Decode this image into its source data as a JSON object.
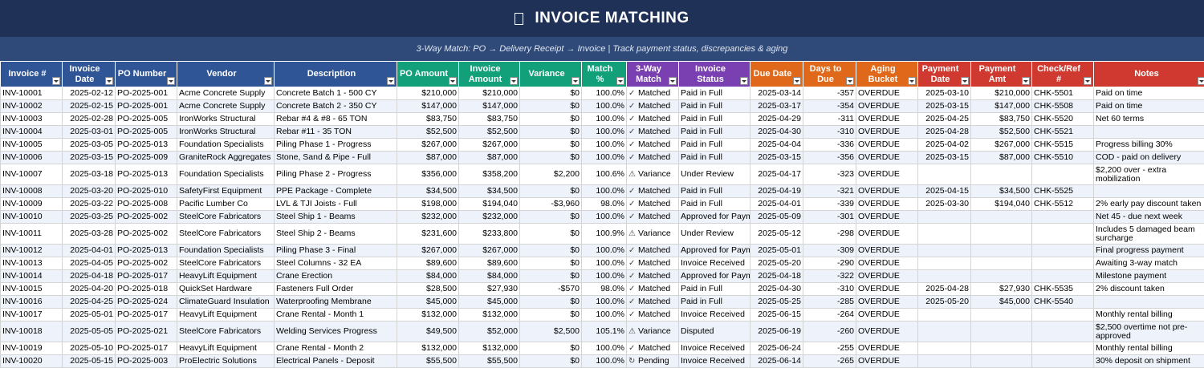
{
  "header": {
    "title": "INVOICE MATCHING",
    "subtitle": "3-Way Match: PO → Delivery Receipt → Invoice  |  Track payment status, discrepancies & aging"
  },
  "columns": [
    {
      "label": "Invoice #",
      "color": "#2f5597"
    },
    {
      "label": "Invoice Date",
      "color": "#2f5597"
    },
    {
      "label": "PO Number",
      "color": "#2f5597"
    },
    {
      "label": "Vendor",
      "color": "#2f5597"
    },
    {
      "label": "Description",
      "color": "#2f5597"
    },
    {
      "label": "PO Amount",
      "color": "#12a07a"
    },
    {
      "label": "Invoice Amount",
      "color": "#12a07a"
    },
    {
      "label": "Variance",
      "color": "#12a07a"
    },
    {
      "label": "Match %",
      "color": "#12a07a"
    },
    {
      "label": "3-Way Match",
      "color": "#7a3fb0"
    },
    {
      "label": "Invoice Status",
      "color": "#7a3fb0"
    },
    {
      "label": "Due Date",
      "color": "#e0681a"
    },
    {
      "label": "Days to Due",
      "color": "#e0681a"
    },
    {
      "label": "Aging Bucket",
      "color": "#e0681a"
    },
    {
      "label": "Payment Date",
      "color": "#d0392f"
    },
    {
      "label": "Payment Amt",
      "color": "#d0392f"
    },
    {
      "label": "Check/Ref #",
      "color": "#d0392f"
    },
    {
      "label": "Notes",
      "color": "#d0392f"
    }
  ],
  "rows": [
    {
      "inv": "INV-10001",
      "date": "2025-02-12",
      "po": "PO-2025-001",
      "vendor": "Acme Concrete Supply",
      "desc": "Concrete Batch 1 - 500 CY",
      "po_amt": "$210,000",
      "inv_amt": "$210,000",
      "var": "$0",
      "pct": "100.0%",
      "match_icon": "check-icon",
      "match_sym": "✓",
      "match": "Matched",
      "status": "Paid in Full",
      "due": "2025-03-14",
      "days": "-357",
      "aging": "OVERDUE",
      "pay_date": "2025-03-10",
      "pay_amt": "$210,000",
      "ref": "CHK-5501",
      "notes": "Paid on time",
      "tall": false
    },
    {
      "inv": "INV-10002",
      "date": "2025-02-15",
      "po": "PO-2025-001",
      "vendor": "Acme Concrete Supply",
      "desc": "Concrete Batch 2 - 350 CY",
      "po_amt": "$147,000",
      "inv_amt": "$147,000",
      "var": "$0",
      "pct": "100.0%",
      "match_icon": "check-icon",
      "match_sym": "✓",
      "match": "Matched",
      "status": "Paid in Full",
      "due": "2025-03-17",
      "days": "-354",
      "aging": "OVERDUE",
      "pay_date": "2025-03-15",
      "pay_amt": "$147,000",
      "ref": "CHK-5508",
      "notes": "Paid on time",
      "tall": false
    },
    {
      "inv": "INV-10003",
      "date": "2025-02-28",
      "po": "PO-2025-005",
      "vendor": "IronWorks Structural",
      "desc": "Rebar #4 & #8 - 65 TON",
      "po_amt": "$83,750",
      "inv_amt": "$83,750",
      "var": "$0",
      "pct": "100.0%",
      "match_icon": "check-icon",
      "match_sym": "✓",
      "match": "Matched",
      "status": "Paid in Full",
      "due": "2025-04-29",
      "days": "-311",
      "aging": "OVERDUE",
      "pay_date": "2025-04-25",
      "pay_amt": "$83,750",
      "ref": "CHK-5520",
      "notes": "Net 60 terms",
      "tall": false
    },
    {
      "inv": "INV-10004",
      "date": "2025-03-01",
      "po": "PO-2025-005",
      "vendor": "IronWorks Structural",
      "desc": "Rebar #11 - 35 TON",
      "po_amt": "$52,500",
      "inv_amt": "$52,500",
      "var": "$0",
      "pct": "100.0%",
      "match_icon": "check-icon",
      "match_sym": "✓",
      "match": "Matched",
      "status": "Paid in Full",
      "due": "2025-04-30",
      "days": "-310",
      "aging": "OVERDUE",
      "pay_date": "2025-04-28",
      "pay_amt": "$52,500",
      "ref": "CHK-5521",
      "notes": "",
      "tall": false
    },
    {
      "inv": "INV-10005",
      "date": "2025-03-05",
      "po": "PO-2025-013",
      "vendor": "Foundation Specialists",
      "desc": "Piling Phase 1 - Progress",
      "po_amt": "$267,000",
      "inv_amt": "$267,000",
      "var": "$0",
      "pct": "100.0%",
      "match_icon": "check-icon",
      "match_sym": "✓",
      "match": "Matched",
      "status": "Paid in Full",
      "due": "2025-04-04",
      "days": "-336",
      "aging": "OVERDUE",
      "pay_date": "2025-04-02",
      "pay_amt": "$267,000",
      "ref": "CHK-5515",
      "notes": "Progress billing 30%",
      "tall": false
    },
    {
      "inv": "INV-10006",
      "date": "2025-03-15",
      "po": "PO-2025-009",
      "vendor": "GraniteRock Aggregates",
      "desc": "Stone, Sand & Pipe - Full",
      "po_amt": "$87,000",
      "inv_amt": "$87,000",
      "var": "$0",
      "pct": "100.0%",
      "match_icon": "check-icon",
      "match_sym": "✓",
      "match": "Matched",
      "status": "Paid in Full",
      "due": "2025-03-15",
      "days": "-356",
      "aging": "OVERDUE",
      "pay_date": "2025-03-15",
      "pay_amt": "$87,000",
      "ref": "CHK-5510",
      "notes": "COD - paid on delivery",
      "tall": false
    },
    {
      "inv": "INV-10007",
      "date": "2025-03-18",
      "po": "PO-2025-013",
      "vendor": "Foundation Specialists",
      "desc": "Piling Phase 2 - Progress",
      "po_amt": "$356,000",
      "inv_amt": "$358,200",
      "var": "$2,200",
      "pct": "100.6%",
      "match_icon": "warning-icon",
      "match_sym": "⚠",
      "match": "Variance",
      "status": "Under Review",
      "due": "2025-04-17",
      "days": "-323",
      "aging": "OVERDUE",
      "pay_date": "",
      "pay_amt": "",
      "ref": "",
      "notes": "$2,200 over - extra mobilization",
      "tall": true
    },
    {
      "inv": "INV-10008",
      "date": "2025-03-20",
      "po": "PO-2025-010",
      "vendor": "SafetyFirst Equipment",
      "desc": "PPE Package - Complete",
      "po_amt": "$34,500",
      "inv_amt": "$34,500",
      "var": "$0",
      "pct": "100.0%",
      "match_icon": "check-icon",
      "match_sym": "✓",
      "match": "Matched",
      "status": "Paid in Full",
      "due": "2025-04-19",
      "days": "-321",
      "aging": "OVERDUE",
      "pay_date": "2025-04-15",
      "pay_amt": "$34,500",
      "ref": "CHK-5525",
      "notes": "",
      "tall": false
    },
    {
      "inv": "INV-10009",
      "date": "2025-03-22",
      "po": "PO-2025-008",
      "vendor": "Pacific Lumber Co",
      "desc": "LVL & TJI Joists - Full",
      "po_amt": "$198,000",
      "inv_amt": "$194,040",
      "var": "-$3,960",
      "pct": "98.0%",
      "match_icon": "check-icon",
      "match_sym": "✓",
      "match": "Matched",
      "status": "Paid in Full",
      "due": "2025-04-01",
      "days": "-339",
      "aging": "OVERDUE",
      "pay_date": "2025-03-30",
      "pay_amt": "$194,040",
      "ref": "CHK-5512",
      "notes": "2% early pay discount taken",
      "tall": false
    },
    {
      "inv": "INV-10010",
      "date": "2025-03-25",
      "po": "PO-2025-002",
      "vendor": "SteelCore Fabricators",
      "desc": "Steel Ship 1 - Beams",
      "po_amt": "$232,000",
      "inv_amt": "$232,000",
      "var": "$0",
      "pct": "100.0%",
      "match_icon": "check-icon",
      "match_sym": "✓",
      "match": "Matched",
      "status": "Approved for Payme",
      "due": "2025-05-09",
      "days": "-301",
      "aging": "OVERDUE",
      "pay_date": "",
      "pay_amt": "",
      "ref": "",
      "notes": "Net 45 - due next week",
      "tall": false
    },
    {
      "inv": "INV-10011",
      "date": "2025-03-28",
      "po": "PO-2025-002",
      "vendor": "SteelCore Fabricators",
      "desc": "Steel Ship 2 - Beams",
      "po_amt": "$231,600",
      "inv_amt": "$233,800",
      "var": "$0",
      "pct": "100.9%",
      "match_icon": "warning-icon",
      "match_sym": "⚠",
      "match": "Variance",
      "status": "Under Review",
      "due": "2025-05-12",
      "days": "-298",
      "aging": "OVERDUE",
      "pay_date": "",
      "pay_amt": "",
      "ref": "",
      "notes": "Includes 5 damaged beam surcharge",
      "tall": true
    },
    {
      "inv": "INV-10012",
      "date": "2025-04-01",
      "po": "PO-2025-013",
      "vendor": "Foundation Specialists",
      "desc": "Piling Phase 3 - Final",
      "po_amt": "$267,000",
      "inv_amt": "$267,000",
      "var": "$0",
      "pct": "100.0%",
      "match_icon": "check-icon",
      "match_sym": "✓",
      "match": "Matched",
      "status": "Approved for Payme",
      "due": "2025-05-01",
      "days": "-309",
      "aging": "OVERDUE",
      "pay_date": "",
      "pay_amt": "",
      "ref": "",
      "notes": "Final progress payment",
      "tall": false
    },
    {
      "inv": "INV-10013",
      "date": "2025-04-05",
      "po": "PO-2025-002",
      "vendor": "SteelCore Fabricators",
      "desc": "Steel Columns - 32 EA",
      "po_amt": "$89,600",
      "inv_amt": "$89,600",
      "var": "$0",
      "pct": "100.0%",
      "match_icon": "check-icon",
      "match_sym": "✓",
      "match": "Matched",
      "status": "Invoice Received",
      "due": "2025-05-20",
      "days": "-290",
      "aging": "OVERDUE",
      "pay_date": "",
      "pay_amt": "",
      "ref": "",
      "notes": "Awaiting 3-way match",
      "tall": false
    },
    {
      "inv": "INV-10014",
      "date": "2025-04-18",
      "po": "PO-2025-017",
      "vendor": "HeavyLift Equipment",
      "desc": "Crane Erection",
      "po_amt": "$84,000",
      "inv_amt": "$84,000",
      "var": "$0",
      "pct": "100.0%",
      "match_icon": "check-icon",
      "match_sym": "✓",
      "match": "Matched",
      "status": "Approved for Payme",
      "due": "2025-04-18",
      "days": "-322",
      "aging": "OVERDUE",
      "pay_date": "",
      "pay_amt": "",
      "ref": "",
      "notes": "Milestone payment",
      "tall": false
    },
    {
      "inv": "INV-10015",
      "date": "2025-04-20",
      "po": "PO-2025-018",
      "vendor": "QuickSet Hardware",
      "desc": "Fasteners Full Order",
      "po_amt": "$28,500",
      "inv_amt": "$27,930",
      "var": "-$570",
      "pct": "98.0%",
      "match_icon": "check-icon",
      "match_sym": "✓",
      "match": "Matched",
      "status": "Paid in Full",
      "due": "2025-04-30",
      "days": "-310",
      "aging": "OVERDUE",
      "pay_date": "2025-04-28",
      "pay_amt": "$27,930",
      "ref": "CHK-5535",
      "notes": "2% discount taken",
      "tall": false
    },
    {
      "inv": "INV-10016",
      "date": "2025-04-25",
      "po": "PO-2025-024",
      "vendor": "ClimateGuard Insulation",
      "desc": "Waterproofing Membrane",
      "po_amt": "$45,000",
      "inv_amt": "$45,000",
      "var": "$0",
      "pct": "100.0%",
      "match_icon": "check-icon",
      "match_sym": "✓",
      "match": "Matched",
      "status": "Paid in Full",
      "due": "2025-05-25",
      "days": "-285",
      "aging": "OVERDUE",
      "pay_date": "2025-05-20",
      "pay_amt": "$45,000",
      "ref": "CHK-5540",
      "notes": "",
      "tall": false
    },
    {
      "inv": "INV-10017",
      "date": "2025-05-01",
      "po": "PO-2025-017",
      "vendor": "HeavyLift Equipment",
      "desc": "Crane Rental - Month 1",
      "po_amt": "$132,000",
      "inv_amt": "$132,000",
      "var": "$0",
      "pct": "100.0%",
      "match_icon": "check-icon",
      "match_sym": "✓",
      "match": "Matched",
      "status": "Invoice Received",
      "due": "2025-06-15",
      "days": "-264",
      "aging": "OVERDUE",
      "pay_date": "",
      "pay_amt": "",
      "ref": "",
      "notes": "Monthly rental billing",
      "tall": false
    },
    {
      "inv": "INV-10018",
      "date": "2025-05-05",
      "po": "PO-2025-021",
      "vendor": "SteelCore Fabricators",
      "desc": "Welding Services Progress",
      "po_amt": "$49,500",
      "inv_amt": "$52,000",
      "var": "$2,500",
      "pct": "105.1%",
      "match_icon": "warning-icon",
      "match_sym": "⚠",
      "match": "Variance",
      "status": "Disputed",
      "due": "2025-06-19",
      "days": "-260",
      "aging": "OVERDUE",
      "pay_date": "",
      "pay_amt": "",
      "ref": "",
      "notes": "$2,500 overtime not pre-approved",
      "tall": true
    },
    {
      "inv": "INV-10019",
      "date": "2025-05-10",
      "po": "PO-2025-017",
      "vendor": "HeavyLift Equipment",
      "desc": "Crane Rental - Month 2",
      "po_amt": "$132,000",
      "inv_amt": "$132,000",
      "var": "$0",
      "pct": "100.0%",
      "match_icon": "check-icon",
      "match_sym": "✓",
      "match": "Matched",
      "status": "Invoice Received",
      "due": "2025-06-24",
      "days": "-255",
      "aging": "OVERDUE",
      "pay_date": "",
      "pay_amt": "",
      "ref": "",
      "notes": "Monthly rental billing",
      "tall": false
    },
    {
      "inv": "INV-10020",
      "date": "2025-05-15",
      "po": "PO-2025-003",
      "vendor": "ProElectric Solutions",
      "desc": "Electrical Panels - Deposit",
      "po_amt": "$55,500",
      "inv_amt": "$55,500",
      "var": "$0",
      "pct": "100.0%",
      "match_icon": "pending-icon",
      "match_sym": "↻",
      "match": "Pending",
      "status": "Invoice Received",
      "due": "2025-06-14",
      "days": "-265",
      "aging": "OVERDUE",
      "pay_date": "",
      "pay_amt": "",
      "ref": "",
      "notes": "30% deposit on shipment",
      "tall": false
    }
  ]
}
